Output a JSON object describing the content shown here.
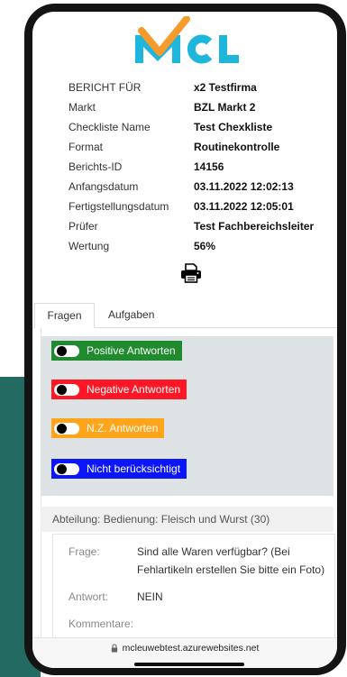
{
  "logo": {
    "text": "MCL",
    "letters_color": "#1fb6dc",
    "check_color": "#f59b2b"
  },
  "report": {
    "rows": [
      {
        "label": "BERICHT FÜR",
        "value": "x2 Testfirma"
      },
      {
        "label": "Markt",
        "value": "BZL Markt 2"
      },
      {
        "label": "Checkliste Name",
        "value": "Test Chexkliste"
      },
      {
        "label": "Format",
        "value": "Routinekontrolle"
      },
      {
        "label": "Berichts-ID",
        "value": "14156"
      },
      {
        "label": "Anfangsdatum",
        "value": "03.11.2022 12:02:13"
      },
      {
        "label": "Fertigstellungsdatum",
        "value": "03.11.2022 12:05:01"
      },
      {
        "label": "Prüfer",
        "value": "Test Fachbereichsleiter"
      },
      {
        "label": "Wertung",
        "value": "56%"
      }
    ],
    "print_icon": "printer-icon"
  },
  "tabs": [
    {
      "label": "Fragen",
      "active": true
    },
    {
      "label": "Aufgaben",
      "active": false
    }
  ],
  "filters": [
    {
      "label": "Positive Antworten",
      "color": "#1f8a2e"
    },
    {
      "label": "Negative Antworten",
      "color": "#ff1726"
    },
    {
      "label": "N.Z. Antworten",
      "color": "#ffa51c"
    },
    {
      "label": "Nicht berücksichtigt",
      "color": "#0b16ff"
    }
  ],
  "section": {
    "title": "Abteilung: Bedienung: Fleisch und Wurst (30)"
  },
  "question": {
    "frage_label": "Frage:",
    "frage_value": "Sind alle Waren verfügbar? (Bei Fehlartikeln erstellen Sie bitte ein Foto)",
    "antwort_label": "Antwort:",
    "antwort_value": "NEIN",
    "kommentare_label": "Kommentare:"
  },
  "browser": {
    "url": "mcleuwebtest.azurewebsites.net",
    "lock_icon": "lock-icon"
  },
  "colors": {
    "background_accent": "#236a62",
    "panel_bg": "#dde2e5"
  }
}
